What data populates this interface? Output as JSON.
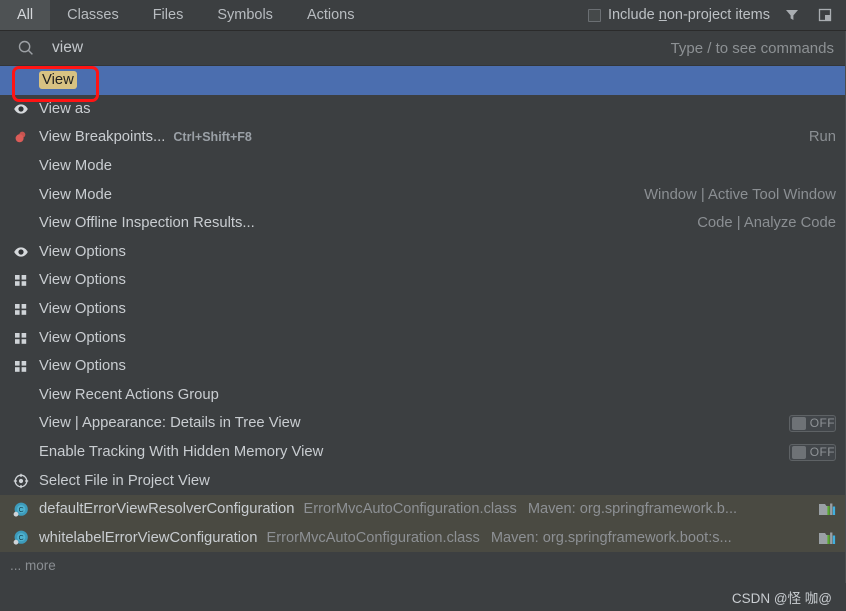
{
  "tabs": [
    {
      "label": "All",
      "active": true
    },
    {
      "label": "Classes",
      "active": false
    },
    {
      "label": "Files",
      "active": false
    },
    {
      "label": "Symbols",
      "active": false
    },
    {
      "label": "Actions",
      "active": false
    }
  ],
  "header": {
    "include_non_project_label_pre": "Include ",
    "include_non_project_accel": "n",
    "include_non_project_label_post": "on-project items",
    "include_non_project_checked": false,
    "filter_icon": "filter-icon",
    "preview_icon": "preview-window-icon"
  },
  "search": {
    "icon": "search-icon",
    "value": "view",
    "placeholder": "Type / to see commands",
    "hint": "Type / to see commands"
  },
  "results": [
    {
      "icon": "none",
      "label": "View",
      "highlight": "View",
      "shortcut": "",
      "right": "",
      "selected": true,
      "toggle": null
    },
    {
      "icon": "eye-icon",
      "label": "View as",
      "shortcut": "",
      "right": "",
      "selected": false,
      "toggle": null
    },
    {
      "icon": "breakpoint-icon",
      "label": "View Breakpoints...",
      "shortcut": "Ctrl+Shift+F8",
      "right": "Run",
      "selected": false,
      "toggle": null
    },
    {
      "icon": "none",
      "label": "View Mode",
      "shortcut": "",
      "right": "",
      "selected": false,
      "toggle": null
    },
    {
      "icon": "none",
      "label": "View Mode",
      "shortcut": "",
      "right": "Window | Active Tool Window",
      "selected": false,
      "toggle": null
    },
    {
      "icon": "none",
      "label": "View Offline Inspection Results...",
      "shortcut": "",
      "right": "Code | Analyze Code",
      "selected": false,
      "toggle": null
    },
    {
      "icon": "eye-icon",
      "label": "View Options",
      "shortcut": "",
      "right": "",
      "selected": false,
      "toggle": null
    },
    {
      "icon": "grid-icon",
      "label": "View Options",
      "shortcut": "",
      "right": "",
      "selected": false,
      "toggle": null
    },
    {
      "icon": "grid-icon",
      "label": "View Options",
      "shortcut": "",
      "right": "",
      "selected": false,
      "toggle": null
    },
    {
      "icon": "grid-icon",
      "label": "View Options",
      "shortcut": "",
      "right": "",
      "selected": false,
      "toggle": null
    },
    {
      "icon": "grid-icon",
      "label": "View Options",
      "shortcut": "",
      "right": "",
      "selected": false,
      "toggle": null
    },
    {
      "icon": "none",
      "label": "View Recent Actions Group",
      "shortcut": "",
      "right": "",
      "selected": false,
      "toggle": null
    },
    {
      "icon": "none",
      "label": "View | Appearance: Details in Tree View",
      "shortcut": "",
      "right": "",
      "selected": false,
      "toggle": "OFF"
    },
    {
      "icon": "none",
      "label": "Enable Tracking With Hidden Memory View",
      "shortcut": "",
      "right": "",
      "selected": false,
      "toggle": "OFF"
    },
    {
      "icon": "crosshair-icon",
      "label": "Select File in Project View",
      "shortcut": "",
      "right": "",
      "selected": false,
      "toggle": null
    }
  ],
  "library_results": [
    {
      "icon": "class-icon",
      "name": "defaultErrorViewResolverConfiguration",
      "file": "ErrorMvcAutoConfiguration.class",
      "path": "Maven: org.springframework.b...",
      "trailing_icon": "library-icon"
    },
    {
      "icon": "class-icon",
      "name": "whitelabelErrorViewConfiguration",
      "file": "ErrorMvcAutoConfiguration.class",
      "path": "Maven: org.springframework.boot:s...",
      "trailing_icon": "library-icon"
    }
  ],
  "footer": {
    "more_label": "... more",
    "watermark": "CSDN @怪 咖@"
  },
  "colors": {
    "background": "#3c3f41",
    "selection": "#4b6eaf",
    "library_row": "#4a4a42",
    "highlight": "#d8c282",
    "annotation": "#ff1414",
    "text": "#c9cdd1",
    "muted_text": "#8d9094"
  }
}
